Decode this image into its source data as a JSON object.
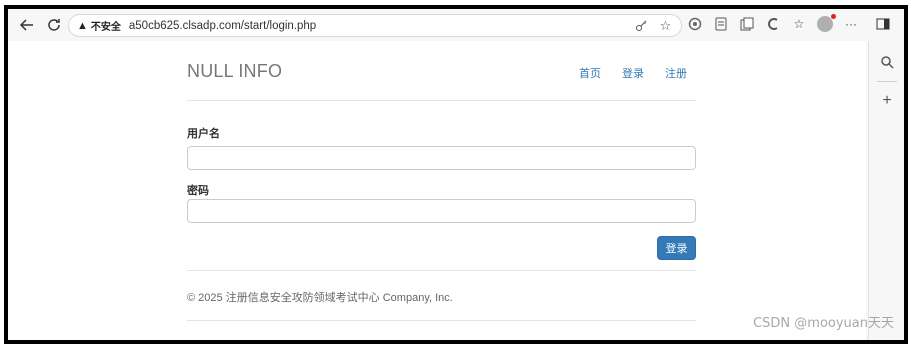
{
  "browser": {
    "insecure_label": "不安全",
    "url": "a50cb625.clsadp.com/start/login.php"
  },
  "page": {
    "brand": "NULL INFO",
    "nav": [
      "首页",
      "登录",
      "注册"
    ],
    "form": {
      "username_label": "用户名",
      "username_value": "",
      "password_label": "密码",
      "password_value": "",
      "submit_label": "登录"
    },
    "footer": "© 2025 注册信息安全攻防领域考试中心 Company, Inc."
  },
  "watermark": "CSDN @mooyuan天天",
  "colors": {
    "link": "#337ab7",
    "button": "#337ab7",
    "brand": "#777777"
  },
  "icons": [
    "back-icon",
    "reload-icon",
    "warning-icon",
    "key-icon",
    "star-icon",
    "extension-icon",
    "reading-view-icon",
    "collections-icon",
    "copilot-icon",
    "favorites-icon",
    "profile-avatar",
    "more-icon",
    "sidebar-toggle-icon",
    "sidebar-search-icon",
    "sidebar-add-icon"
  ]
}
